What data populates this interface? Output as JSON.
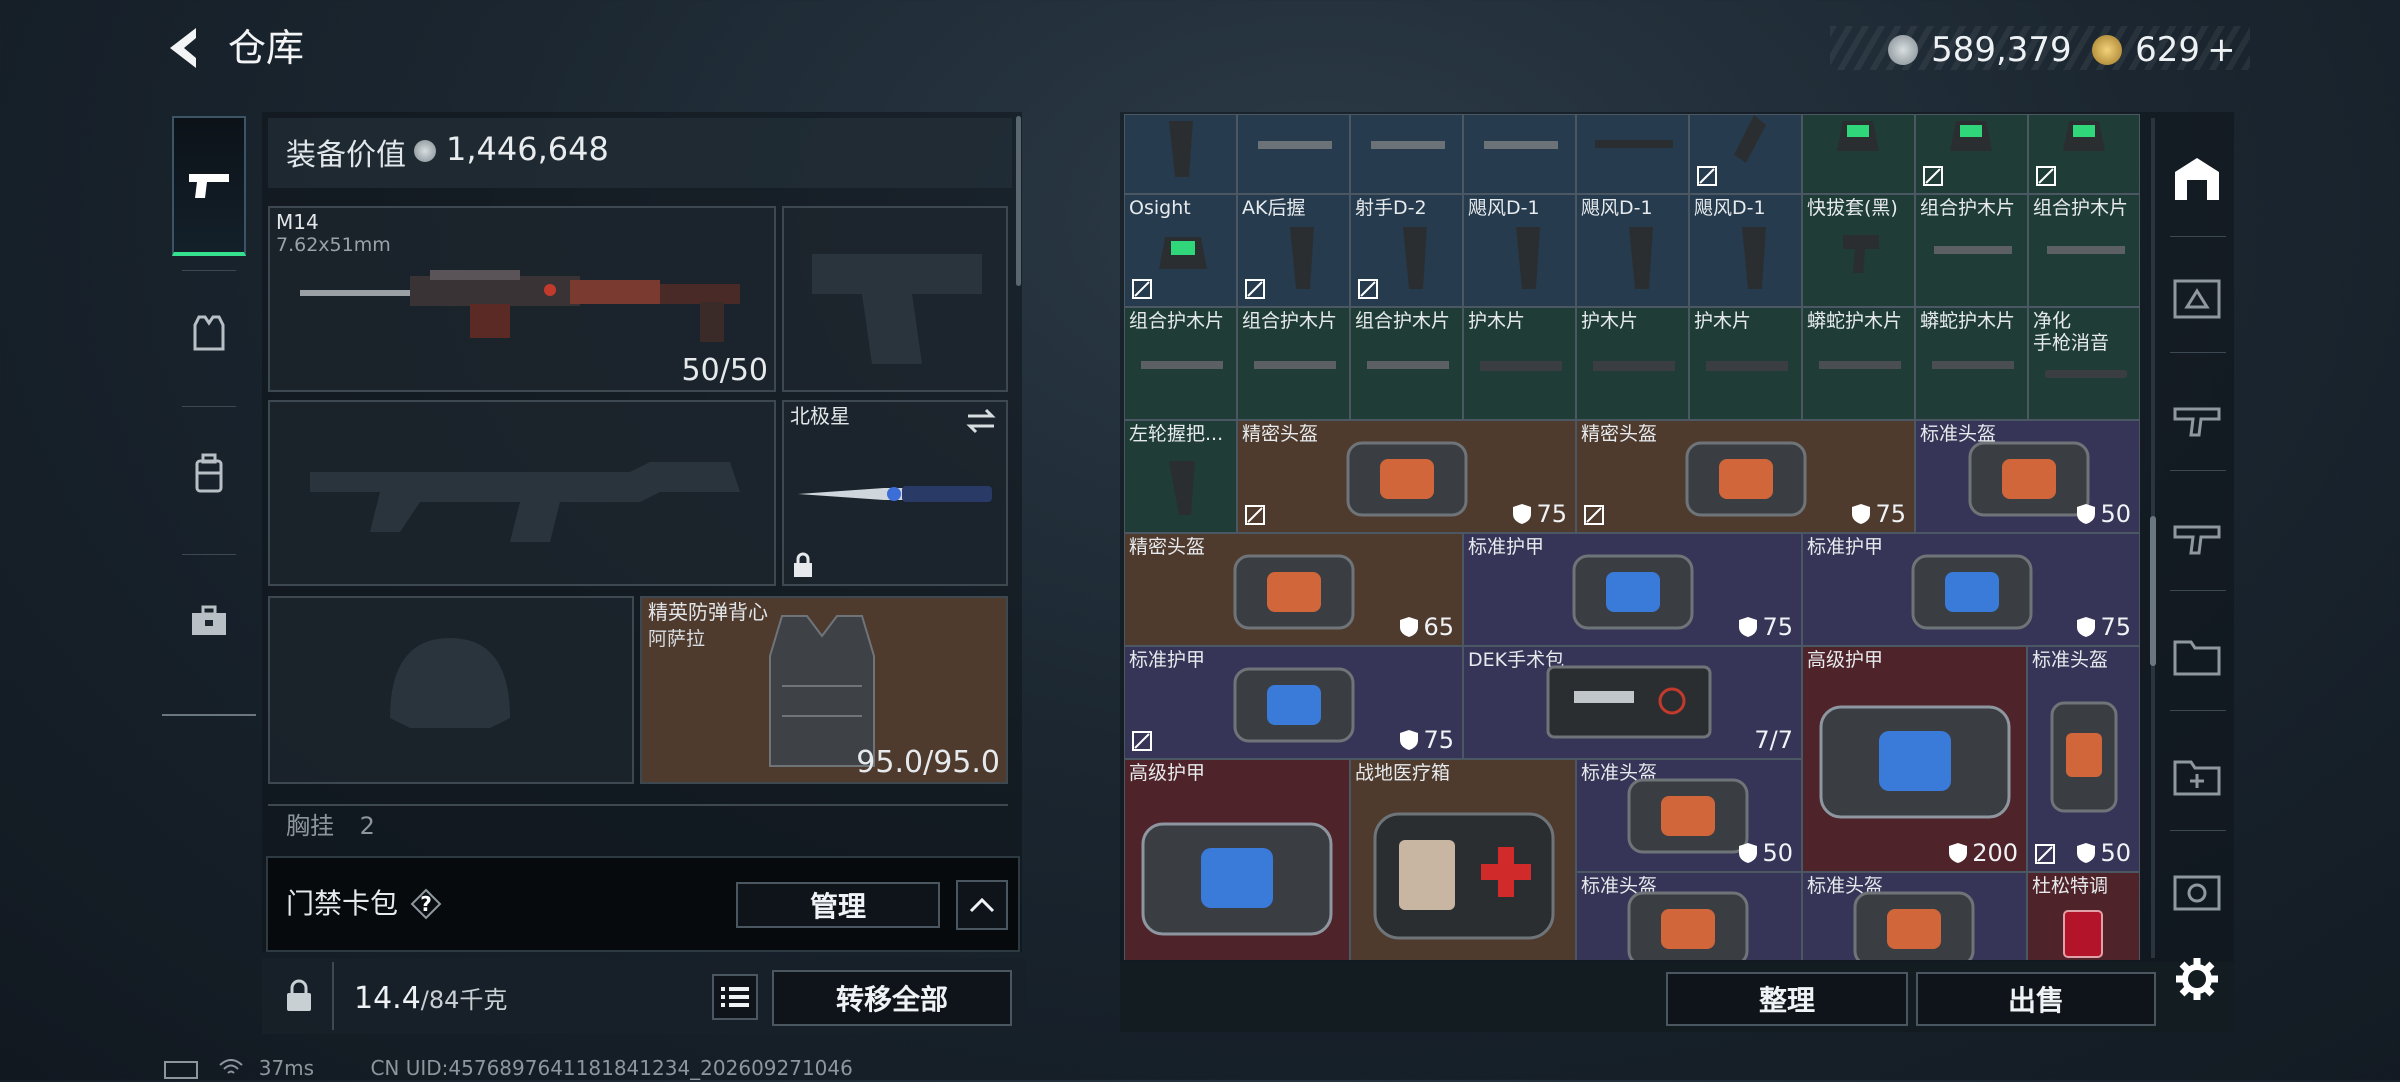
{
  "header": {
    "title": "仓库"
  },
  "currency": {
    "coins": "589,379",
    "premium": "629",
    "plus": "+"
  },
  "equipment": {
    "value_label": "装备价值",
    "value": "1,446,648",
    "primary": {
      "name": "M14",
      "caliber": "7.62x51mm",
      "ammo": "50/50"
    },
    "melee": {
      "name": "北极星"
    },
    "vest": {
      "name_line1": "精英防弹背心",
      "name_line2": "阿萨拉",
      "durability": "95.0/95.0"
    },
    "chest_label": "胸挂",
    "chest_count": "2"
  },
  "card_pack": {
    "label": "门禁卡包",
    "help": "?",
    "manage_label": "管理"
  },
  "bottom": {
    "weight_value": "14.4",
    "weight_max": "/84千克",
    "transfer_label": "转移全部"
  },
  "status": {
    "ping": "37ms",
    "uid": "CN UID:4576897641181841234_202609271046"
  },
  "grid": {
    "row0": [
      "",
      "",
      "",
      "",
      "",
      "",
      "",
      "",
      ""
    ],
    "row1": [
      "Osight",
      "AK后握",
      "射手D-2",
      "飓风D-1",
      "飓风D-1",
      "飓风D-1",
      "快拔套(黑)",
      "组合护木片",
      "组合护木片"
    ],
    "row2": [
      "组合护木片",
      "组合护木片",
      "组合护木片",
      "护木片",
      "护木片",
      "护木片",
      "蟒蛇护木片",
      "蟒蛇护木片",
      "净化\n手枪消音"
    ],
    "row3": [
      {
        "label": "左轮握把...",
        "dur": ""
      },
      {
        "label": "精密头盔",
        "dur": "75"
      },
      {
        "label": "精密头盔",
        "dur": "75"
      },
      {
        "label": "标准头盔",
        "dur": "50"
      }
    ],
    "row4": [
      {
        "label": "精密头盔",
        "dur": "65"
      },
      {
        "label": "标准护甲",
        "dur": "75"
      },
      {
        "label": "标准护甲",
        "dur": "75"
      }
    ],
    "row5": [
      {
        "label": "标准护甲",
        "dur": "75"
      },
      {
        "label": "DEK手术包",
        "dur": "7/7"
      },
      {
        "label": "高级护甲",
        "dur": "200"
      },
      {
        "label": "标准头盔",
        "dur": "50"
      }
    ],
    "row6": [
      {
        "label": "高级护甲",
        "dur": ""
      },
      {
        "label": "战地医疗箱",
        "dur": ""
      },
      {
        "label": "标准头盔",
        "dur": "50"
      },
      {
        "label": "标准头盔",
        "dur": ""
      },
      {
        "label": "标准头盔",
        "dur": ""
      },
      {
        "label": "杜松特调",
        "dur": ""
      }
    ],
    "sort_label": "整理",
    "sell_label": "出售"
  },
  "colors": {
    "accent_green": "#35e08e",
    "panel": "#1e2a35"
  }
}
